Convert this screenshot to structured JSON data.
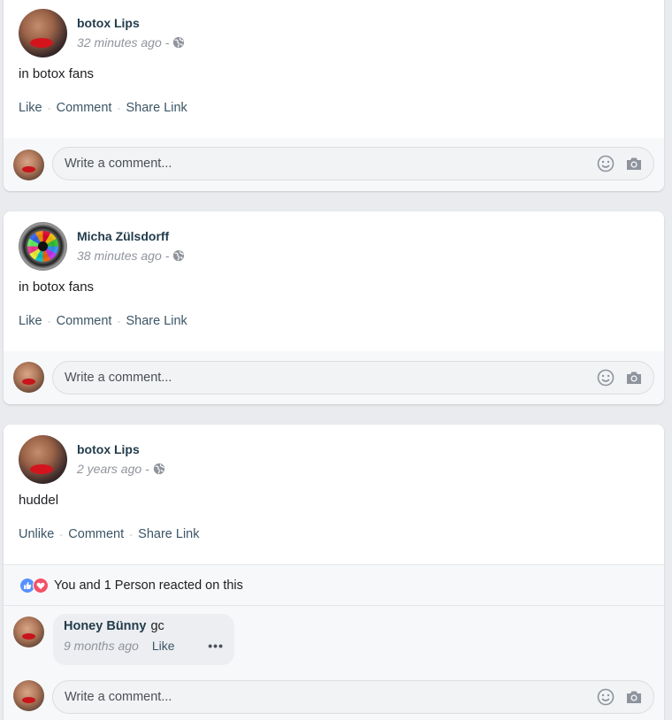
{
  "posts": [
    {
      "author": "botox Lips",
      "time": "32 minutes ago",
      "meta_sep": "-",
      "text": "in botox fans",
      "actions": [
        "Like",
        "Comment",
        "Share Link"
      ],
      "comment_placeholder": "Write a comment..."
    },
    {
      "author": "Micha Zülsdorff",
      "time": "38 minutes ago",
      "meta_sep": "-",
      "text": "in botox fans",
      "actions": [
        "Like",
        "Comment",
        "Share Link"
      ],
      "comment_placeholder": "Write a comment..."
    },
    {
      "author": "botox Lips",
      "time": "2 years ago",
      "meta_sep": "-",
      "text": "huddel",
      "actions": [
        "Unlike",
        "Comment",
        "Share Link"
      ],
      "reactions_text": "You and 1 Person reacted on this",
      "comment": {
        "author": "Honey Bünny",
        "text": "gc",
        "time": "9 months ago",
        "like": "Like",
        "more": "•••"
      },
      "comment_placeholder": "Write a comment..."
    }
  ],
  "icons": {
    "privacy": "globe-icon",
    "emoji": "smiley-icon",
    "photo": "camera-icon",
    "reaction_like": "like-reaction-icon",
    "reaction_love": "love-reaction-icon"
  },
  "colors": {
    "link": "#3b5566",
    "author": "#233c4b",
    "like_blue": "#5890ff",
    "love_red": "#f25268"
  }
}
